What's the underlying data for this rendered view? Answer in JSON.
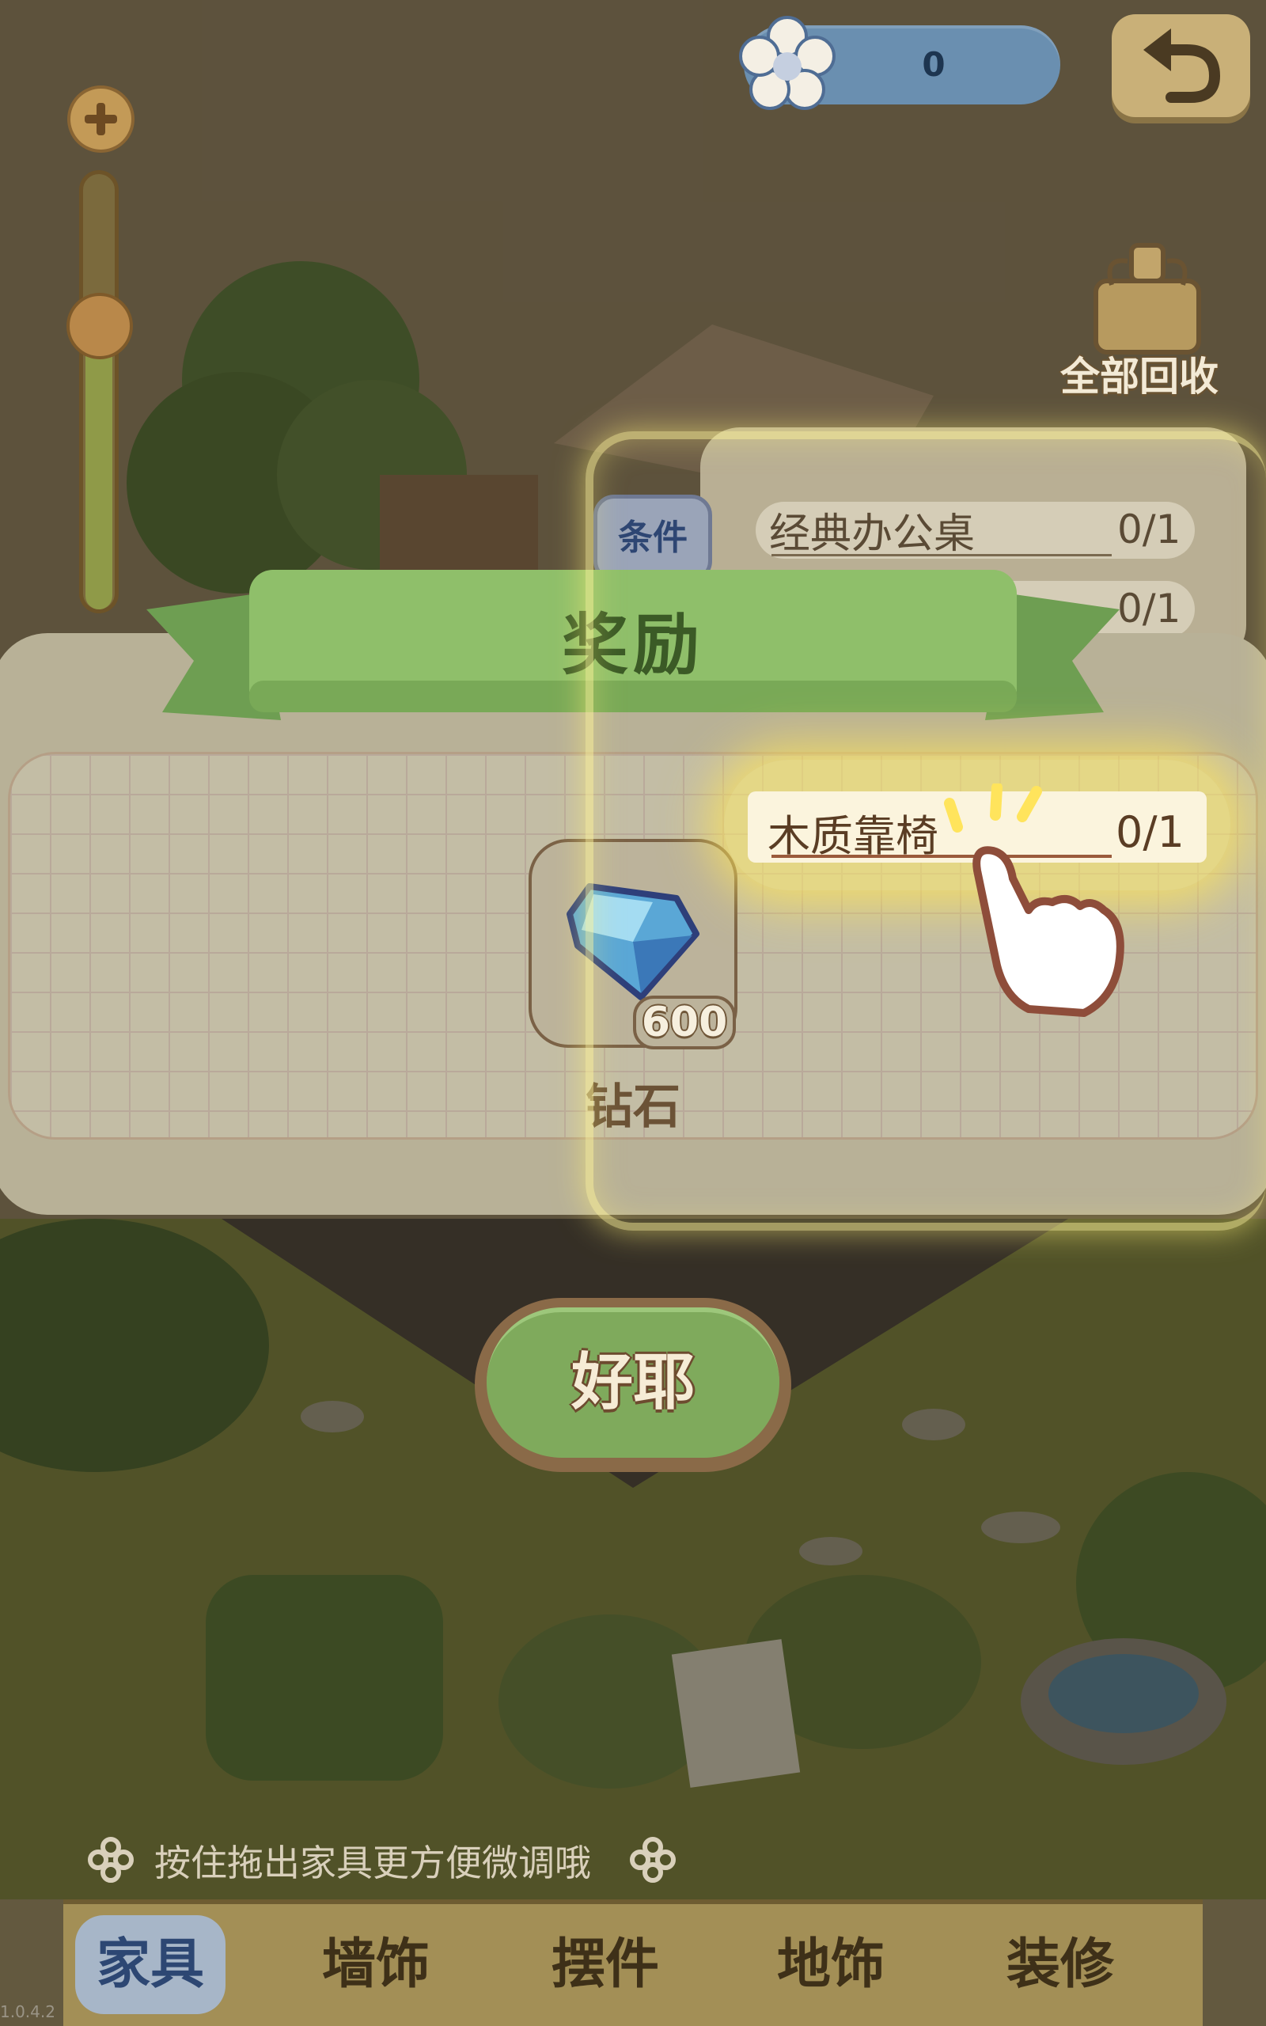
{
  "hud": {
    "currency_value": "0",
    "currency_icon": "flower-icon",
    "back_icon": "undo-arrow-icon",
    "recycle_label": "全部回收"
  },
  "conditions": {
    "tab_label": "条件",
    "items": [
      {
        "name": "经典办公桌",
        "count": "0/1"
      },
      {
        "name": "",
        "count": "0/1"
      },
      {
        "name": "木质靠椅",
        "count": "0/1"
      }
    ]
  },
  "reward": {
    "title": "奖励",
    "item_name": "钻石",
    "item_amount": "600",
    "item_icon": "diamond-icon",
    "confirm_label": "好耶"
  },
  "hint": "按住拖出家具更方便微调哦",
  "tabs": [
    {
      "label": "家具",
      "active": true
    },
    {
      "label": "墙饰",
      "active": false
    },
    {
      "label": "摆件",
      "active": false
    },
    {
      "label": "地饰",
      "active": false
    },
    {
      "label": "装修",
      "active": false
    }
  ],
  "version": "1.0.4.2",
  "colors": {
    "ribbon_green": "#8fbf6a",
    "panel_beige": "#b8b197",
    "highlight_yellow": "#ffe86a",
    "tab_active": "#a7b6c8"
  }
}
